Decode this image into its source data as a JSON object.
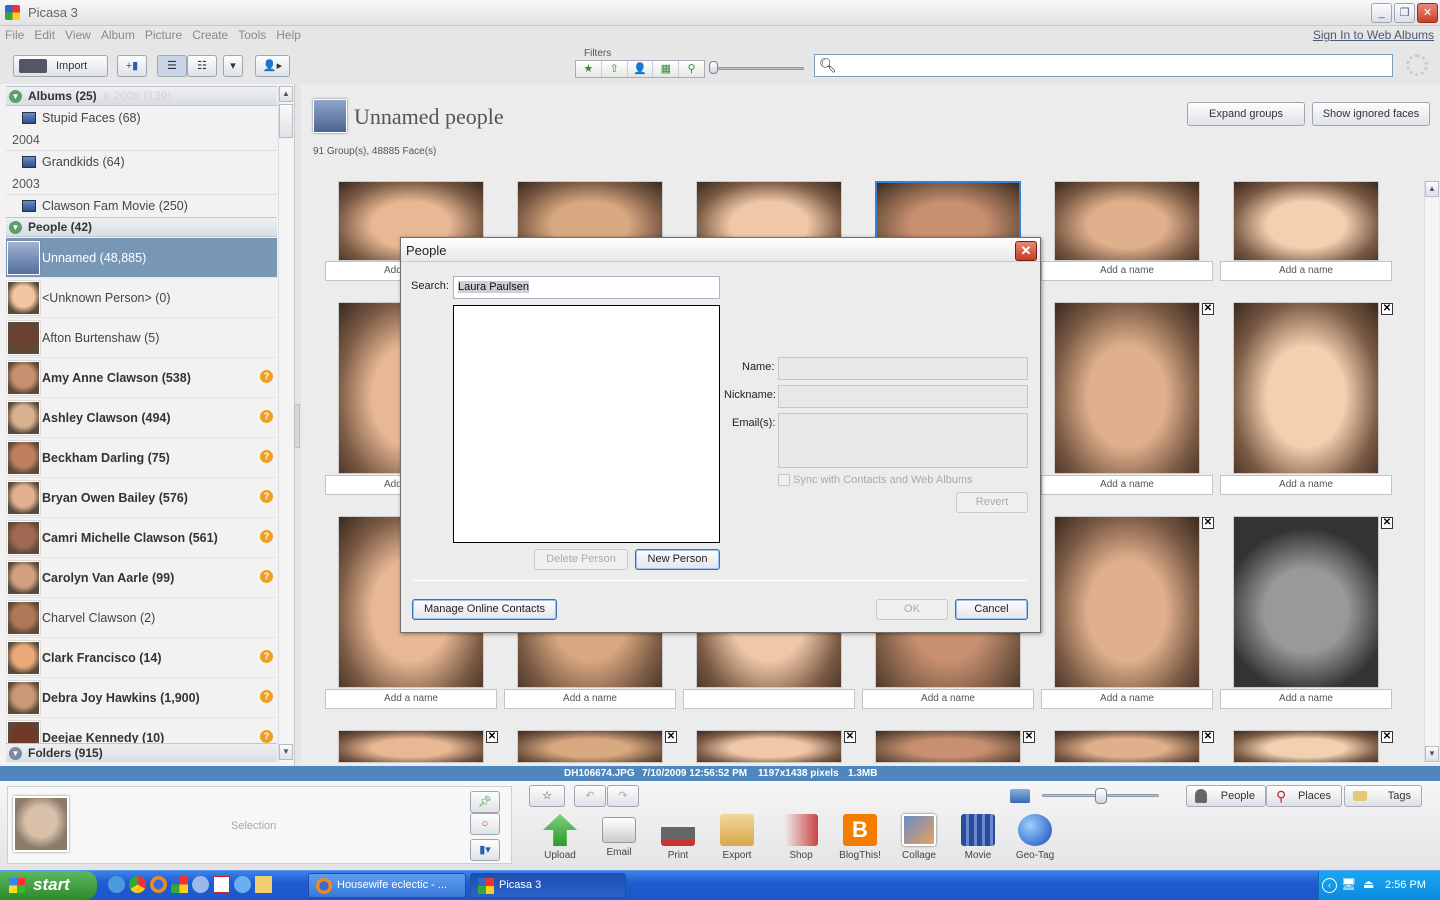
{
  "window": {
    "title": "Picasa 3"
  },
  "menu": [
    "File",
    "Edit",
    "View",
    "Album",
    "Picture",
    "Create",
    "Tools",
    "Help"
  ],
  "signin": "Sign In to Web Albums",
  "toolbar": {
    "import_label": "Import",
    "filters_label": "Filters"
  },
  "search": {
    "placeholder": ""
  },
  "left": {
    "albums_header": "Albums (25)",
    "albums_header_ghost": "k 2008 (139)",
    "albums": [
      {
        "name": "Stupid Faces (68)"
      },
      {
        "year": "2004"
      },
      {
        "name": "Grandkids (64)"
      },
      {
        "year": "2003"
      },
      {
        "name": "Clawson Fam Movie (250)"
      }
    ],
    "people_header": "People (42)",
    "people": [
      {
        "name": "Unnamed (48,885)",
        "selected": true,
        "bold": false,
        "flag": false
      },
      {
        "name": "<Unknown Person> (0)",
        "bold": false,
        "flag": false
      },
      {
        "name": "Afton Burtenshaw (5)",
        "bold": false,
        "flag": false
      },
      {
        "name": "Amy Anne Clawson (538)",
        "bold": true,
        "flag": true
      },
      {
        "name": "Ashley Clawson (494)",
        "bold": true,
        "flag": true
      },
      {
        "name": "Beckham Darling (75)",
        "bold": true,
        "flag": true
      },
      {
        "name": "Bryan Owen Bailey (576)",
        "bold": true,
        "flag": true
      },
      {
        "name": "Camri Michelle Clawson (561)",
        "bold": true,
        "flag": true
      },
      {
        "name": "Carolyn Van Aarle (99)",
        "bold": true,
        "flag": true
      },
      {
        "name": "Charvel Clawson (2)",
        "bold": false,
        "flag": false
      },
      {
        "name": "Clark Francisco (14)",
        "bold": true,
        "flag": true
      },
      {
        "name": "Debra Joy Hawkins (1,900)",
        "bold": true,
        "flag": true
      },
      {
        "name": "Deejae Kennedy (10)",
        "bold": true,
        "flag": true
      }
    ],
    "folders_header": "Folders (915)"
  },
  "main": {
    "title": "Unnamed people",
    "subtitle": "91 Group(s), 48885 Face(s)",
    "expand_btn": "Expand groups",
    "ignored_btn": "Show ignored faces",
    "add_name": "Add a name",
    "add_name_partial": "Add"
  },
  "status": {
    "file": "DH106674.JPG",
    "date": "7/10/2009 12:56:52 PM",
    "size": "1197x1438 pixels",
    "bytes": "1.3MB"
  },
  "tray": {
    "selection_label": "Selection",
    "buttons": [
      "Upload",
      "Email",
      "Print",
      "Export",
      "Shop",
      "BlogThis!",
      "Collage",
      "Movie",
      "Geo-Tag"
    ],
    "tabs": [
      "People",
      "Places",
      "Tags"
    ]
  },
  "taskbar": {
    "start": "start",
    "items": [
      "Housewife eclectic - ...",
      "Picasa 3"
    ],
    "clock": "2:56 PM"
  },
  "dialog": {
    "title": "People",
    "search_label": "Search:",
    "search_value": "Laura Paulsen",
    "name_label": "Name:",
    "nickname_label": "Nickname:",
    "emails_label": "Email(s):",
    "sync_label": "Sync with Contacts and Web Albums",
    "revert": "Revert",
    "delete_person": "Delete Person",
    "new_person": "New Person",
    "manage": "Manage Online Contacts",
    "ok": "OK",
    "cancel": "Cancel"
  },
  "colors": {
    "accent": "#4e86bd",
    "selected": "#7897b4",
    "flag": "#f0a020"
  }
}
